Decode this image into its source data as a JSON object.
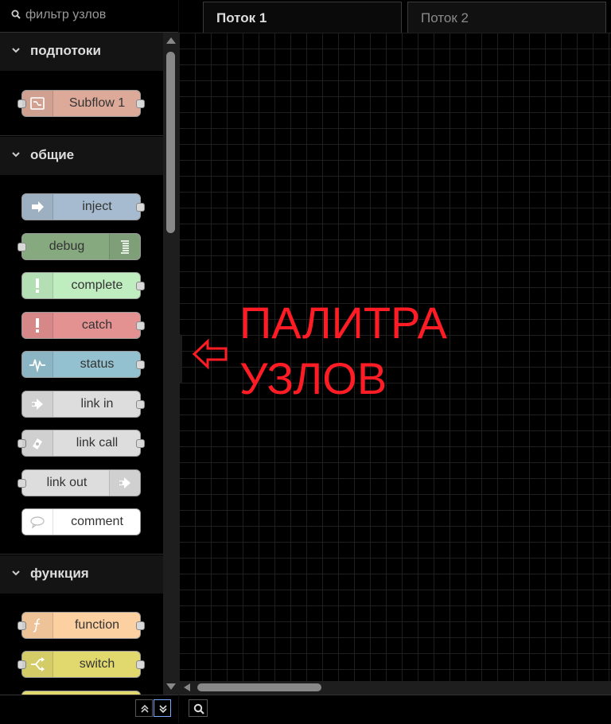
{
  "palette": {
    "filter_placeholder": "фильтр узлов",
    "categories": [
      {
        "label": "подпотоки",
        "nodes": [
          {
            "label": "Subflow 1",
            "color": "#ddaa99",
            "icon": "subflow-icon"
          }
        ]
      },
      {
        "label": "общие",
        "nodes": [
          {
            "label": "inject",
            "color": "#a6bbcf",
            "icon": "inject-arrow-icon"
          },
          {
            "label": "debug",
            "color": "#87a980",
            "icon": "debug-list-icon"
          },
          {
            "label": "complete",
            "color": "#c0edc0",
            "icon": "exclamation-icon"
          },
          {
            "label": "catch",
            "color": "#e49191",
            "icon": "exclamation-icon"
          },
          {
            "label": "status",
            "color": "#94c1d0",
            "icon": "pulse-icon"
          },
          {
            "label": "link in",
            "color": "#dddddd",
            "icon": "link-in-icon"
          },
          {
            "label": "link call",
            "color": "#dddddd",
            "icon": "link-call-icon"
          },
          {
            "label": "link out",
            "color": "#dddddd",
            "icon": "link-out-icon"
          },
          {
            "label": "comment",
            "color": "#ffffff",
            "icon": "comment-icon"
          }
        ]
      },
      {
        "label": "функция",
        "nodes": [
          {
            "label": "function",
            "color": "#fdd0a2",
            "icon": "function-icon"
          },
          {
            "label": "switch",
            "color": "#e2d96e",
            "icon": "switch-icon"
          }
        ]
      }
    ]
  },
  "tabs": [
    {
      "label": "Поток 1",
      "active": true
    },
    {
      "label": "Поток 2",
      "active": false
    }
  ],
  "annotation": {
    "text": "ПАЛИТРА\nУЗЛОВ",
    "color": "#ff1c24"
  }
}
